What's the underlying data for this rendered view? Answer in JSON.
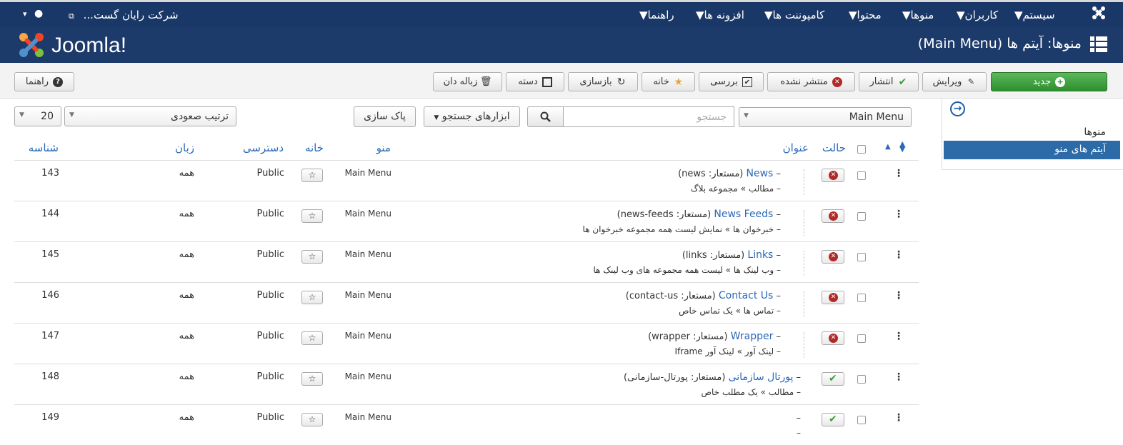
{
  "topbar": {
    "menu": [
      "سیستم",
      "کاربران",
      "منوها",
      "محتوا",
      "کامپوننت ها",
      "افزونه ها",
      "راهنما"
    ],
    "site": "شرکت رایان گست..."
  },
  "header": {
    "title": "منوها: آیتم ها (Main Menu)",
    "logo_text": "Joomla!"
  },
  "toolbar": {
    "new": "جدید",
    "edit": "ویرایش",
    "publish": "انتشار",
    "unpublish": "منتشر نشده",
    "checkin": "بررسی",
    "home": "خانه",
    "rebuild": "بازسازی",
    "batch": "دسته",
    "trash": "زباله دان",
    "help": "راهنما"
  },
  "sidebar": {
    "menus": "منوها",
    "menu_items": "آیتم های منو"
  },
  "filters": {
    "menu_select": "Main Menu",
    "search_placeholder": "جستجو",
    "search_tools": "ابزارهای جستجو",
    "clear": "پاک سازی",
    "ordering": "ترتیب صعودی",
    "limit": "20"
  },
  "table": {
    "headers": {
      "status": "حالت",
      "title": "عنوان",
      "menu": "منو",
      "home": "خانه",
      "access": "دسترسی",
      "language": "زبان",
      "id": "شناسه"
    },
    "rows": [
      {
        "title": "News",
        "alias": "(مستعار: news)",
        "sub": "مطالب » مجموعه بلاگ",
        "published": false,
        "menu": "Main Menu",
        "access": "Public",
        "language": "همه",
        "id": "143"
      },
      {
        "title": "News Feeds",
        "alias": "(مستعار: news-feeds)",
        "sub": "خبرخوان ها » نمایش لیست همه مجموعه خبرخوان ها",
        "published": false,
        "menu": "Main Menu",
        "access": "Public",
        "language": "همه",
        "id": "144"
      },
      {
        "title": "Links",
        "alias": "(مستعار: links)",
        "sub": "وب لینک ها » لیست همه مجموعه های وب لینک ها",
        "published": false,
        "menu": "Main Menu",
        "access": "Public",
        "language": "همه",
        "id": "145"
      },
      {
        "title": "Contact Us",
        "alias": "(مستعار: contact-us)",
        "sub": "تماس ها » یک تماس خاص",
        "published": false,
        "menu": "Main Menu",
        "access": "Public",
        "language": "همه",
        "id": "146"
      },
      {
        "title": "Wrapper",
        "alias": "(مستعار: wrapper)",
        "sub": "لینک آور » لینک آور Iframe",
        "published": false,
        "menu": "Main Menu",
        "access": "Public",
        "language": "همه",
        "id": "147"
      },
      {
        "title": "پورتال سازمانی",
        "alias": "(مستعار: پورتال-سازمانی)",
        "sub": "مطالب » یک مطلب خاص",
        "published": true,
        "menu": "Main Menu",
        "access": "Public",
        "language": "همه",
        "id": "148"
      },
      {
        "title": "",
        "alias": "",
        "sub": "",
        "published": true,
        "menu": "Main Menu",
        "access": "Public",
        "language": "همه",
        "id": "149"
      }
    ]
  },
  "colors": {
    "topbar": "#1a3867",
    "header": "#1d3b6a",
    "link": "#2a69b8",
    "green": "#3c9c3c",
    "red": "#b02b27"
  }
}
